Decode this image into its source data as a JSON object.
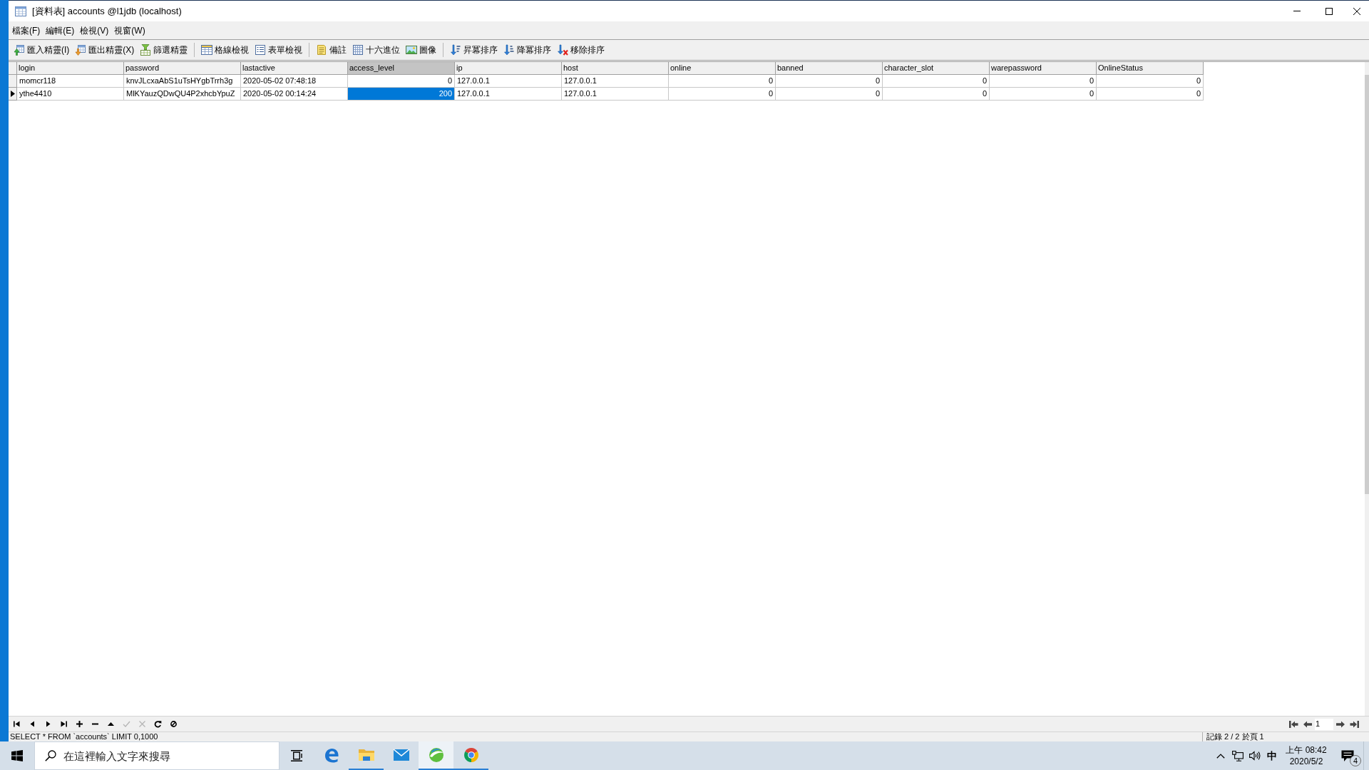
{
  "window": {
    "title": "[資料表] accounts @l1jdb (localhost)",
    "menu": [
      "檔案(F)",
      "編輯(E)",
      "檢視(V)",
      "視窗(W)"
    ],
    "toolbar_groups": [
      [
        "匯入精靈(I)",
        "匯出精靈(X)",
        "篩選精靈"
      ],
      [
        "格線檢視",
        "表單檢視"
      ],
      [
        "備註",
        "十六進位",
        "圖像"
      ],
      [
        "昇冪排序",
        "降冪排序",
        "移除排序"
      ]
    ],
    "table": {
      "columns": [
        {
          "label": "login",
          "selected": false,
          "kind": "text"
        },
        {
          "label": "password",
          "selected": false,
          "kind": "text"
        },
        {
          "label": "lastactive",
          "selected": false,
          "kind": "text"
        },
        {
          "label": "access_level",
          "selected": true,
          "kind": "number"
        },
        {
          "label": "ip",
          "selected": false,
          "kind": "text"
        },
        {
          "label": "host",
          "selected": false,
          "kind": "text"
        },
        {
          "label": "online",
          "selected": false,
          "kind": "number"
        },
        {
          "label": "banned",
          "selected": false,
          "kind": "number"
        },
        {
          "label": "character_slot",
          "selected": false,
          "kind": "number"
        },
        {
          "label": "warepassword",
          "selected": false,
          "kind": "number"
        },
        {
          "label": "OnlineStatus",
          "selected": false,
          "kind": "number"
        }
      ],
      "rows": [
        {
          "selected": false,
          "cells": [
            "momcr118",
            "knvJLcxaAbS1uTsHYgbTrrh3g",
            "2020-05-02 07:48:18",
            "0",
            "127.0.0.1",
            "127.0.0.1",
            "0",
            "0",
            "0",
            "0",
            "0"
          ]
        },
        {
          "selected": true,
          "cells": [
            "ythe4410",
            "MlKYauzQDwQU4P2xhcbYpuZ",
            "2020-05-02 00:14:24",
            "200",
            "127.0.0.1",
            "127.0.0.1",
            "0",
            "0",
            "0",
            "0",
            "0"
          ]
        }
      ]
    },
    "record_nav": {
      "buttons": [
        {
          "disabled": false
        },
        {
          "disabled": false
        },
        {
          "disabled": false
        },
        {
          "disabled": false
        },
        {
          "disabled": false
        },
        {
          "disabled": false
        },
        {
          "disabled": false
        },
        {
          "disabled": true
        },
        {
          "disabled": true
        },
        {
          "disabled": false
        },
        {
          "disabled": false
        }
      ]
    },
    "pager": {
      "page": "1"
    },
    "status_bar": {
      "query": "SELECT * FROM `accounts` LIMIT 0,1000",
      "records": "記錄 2 / 2 於頁 1"
    }
  },
  "taskbar": {
    "search_placeholder": "在這裡輸入文字來搜尋",
    "apps": [
      {
        "running": false,
        "active": false
      },
      {
        "running": true,
        "active": false
      },
      {
        "running": false,
        "active": false
      },
      {
        "running": true,
        "active": true
      },
      {
        "running": true,
        "active": false
      }
    ],
    "tray": {
      "input_mode": "中",
      "time": "上午 08:42",
      "date": "2020/5/2",
      "notification_count": "4"
    }
  }
}
